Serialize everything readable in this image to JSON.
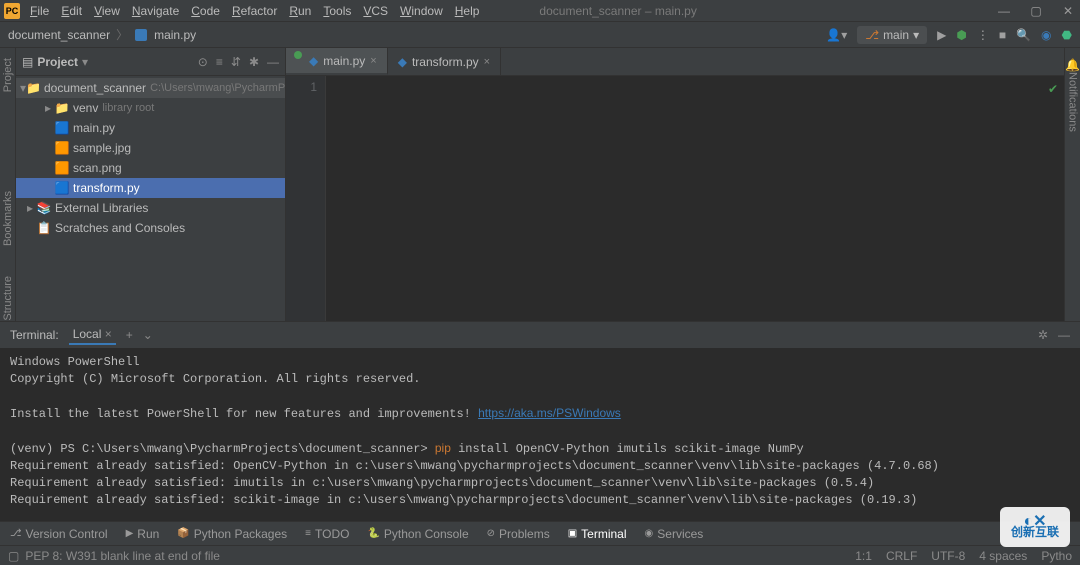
{
  "menu": [
    "File",
    "Edit",
    "View",
    "Navigate",
    "Code",
    "Refactor",
    "Run",
    "Tools",
    "VCS",
    "Window",
    "Help"
  ],
  "window_title": "document_scanner – main.py",
  "breadcrumb": {
    "project": "document_scanner",
    "file": "main.py"
  },
  "branch": "main",
  "project_panel": {
    "title": "Project",
    "nodes": [
      {
        "level": 0,
        "arrow": "▾",
        "icon": "folder",
        "label": "document_scanner",
        "hint": "C:\\Users\\mwang\\PycharmProjects",
        "cls": "root"
      },
      {
        "level": 1,
        "arrow": "▸",
        "icon": "folder",
        "label": "venv",
        "hint": "library root",
        "cls": ""
      },
      {
        "level": 1,
        "arrow": "",
        "icon": "py",
        "label": "main.py",
        "hint": "",
        "cls": ""
      },
      {
        "level": 1,
        "arrow": "",
        "icon": "img",
        "label": "sample.jpg",
        "hint": "",
        "cls": ""
      },
      {
        "level": 1,
        "arrow": "",
        "icon": "img",
        "label": "scan.png",
        "hint": "",
        "cls": ""
      },
      {
        "level": 1,
        "arrow": "",
        "icon": "py",
        "label": "transform.py",
        "hint": "",
        "cls": "selected"
      },
      {
        "level": 0,
        "arrow": "▸",
        "icon": "lib",
        "label": "External Libraries",
        "hint": "",
        "cls": ""
      },
      {
        "level": 0,
        "arrow": "",
        "icon": "scratch",
        "label": "Scratches and Consoles",
        "hint": "",
        "cls": ""
      }
    ]
  },
  "tabs": [
    {
      "label": "main.py",
      "active": true,
      "run": true
    },
    {
      "label": "transform.py",
      "active": false,
      "run": false
    }
  ],
  "gutter_line": "1",
  "terminal": {
    "title": "Terminal:",
    "tab": "Local",
    "lines": [
      {
        "t": "Windows PowerShell"
      },
      {
        "t": "Copyright (C) Microsoft Corporation. All rights reserved."
      },
      {
        "t": ""
      },
      {
        "prefix": "Install the latest PowerShell for new features and improvements! ",
        "link": "https://aka.ms/PSWindows"
      },
      {
        "t": ""
      },
      {
        "prompt": "(venv) PS C:\\Users\\mwang\\PycharmProjects\\document_scanner> ",
        "cmd": "pip",
        "rest": " install OpenCV-Python imutils scikit-image NumPy"
      },
      {
        "t": "Requirement already satisfied: OpenCV-Python in c:\\users\\mwang\\pycharmprojects\\document_scanner\\venv\\lib\\site-packages (4.7.0.68)"
      },
      {
        "t": "Requirement already satisfied: imutils in c:\\users\\mwang\\pycharmprojects\\document_scanner\\venv\\lib\\site-packages (0.5.4)"
      },
      {
        "t": "Requirement already satisfied: scikit-image in c:\\users\\mwang\\pycharmprojects\\document_scanner\\venv\\lib\\site-packages (0.19.3)"
      }
    ]
  },
  "tool_windows": [
    "Version Control",
    "Run",
    "Python Packages",
    "TODO",
    "Python Console",
    "Problems",
    "Terminal",
    "Services"
  ],
  "tool_windows_active": "Terminal",
  "status": {
    "left": "PEP 8: W391 blank line at end of file",
    "pos": "1:1",
    "eol": "CRLF",
    "enc": "UTF-8",
    "indent": "4 spaces",
    "lang": "Pytho"
  },
  "rails": {
    "left": [
      "Project",
      "Bookmarks",
      "Structure"
    ],
    "right": "Notifications"
  },
  "watermark": "创新互联"
}
